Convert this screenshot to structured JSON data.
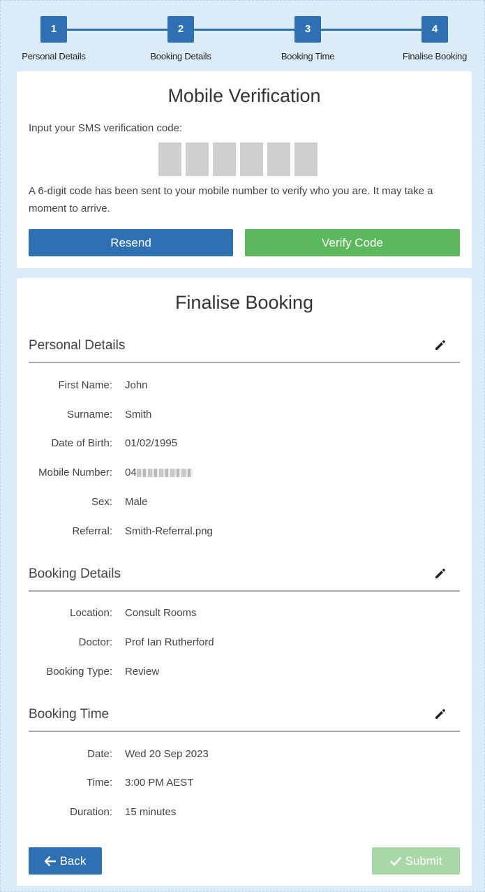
{
  "stepper": {
    "steps": [
      {
        "number": "1",
        "label": "Personal Details"
      },
      {
        "number": "2",
        "label": "Booking Details"
      },
      {
        "number": "3",
        "label": "Booking Time"
      },
      {
        "number": "4",
        "label": "Finalise Booking"
      }
    ]
  },
  "verify": {
    "title": "Mobile Verification",
    "prompt": "Input your SMS verification code:",
    "code_digits": [
      "",
      "",
      "",
      "",
      "",
      ""
    ],
    "note": "A 6-digit code has been sent to your mobile number to verify who you are. It may take a moment to arrive.",
    "resend_label": "Resend",
    "verify_label": "Verify Code"
  },
  "finalise": {
    "title": "Finalise Booking",
    "personal": {
      "heading": "Personal Details",
      "rows": [
        {
          "label": "First Name:",
          "value": "John"
        },
        {
          "label": "Surname:",
          "value": "Smith"
        },
        {
          "label": "Date of Birth:",
          "value": "01/02/1995"
        },
        {
          "label": "Mobile Number:",
          "value": "04"
        },
        {
          "label": "Sex:",
          "value": "Male"
        },
        {
          "label": "Referral:",
          "value": "Smith-Referral.png"
        }
      ]
    },
    "booking": {
      "heading": "Booking Details",
      "rows": [
        {
          "label": "Location:",
          "value": "Consult Rooms"
        },
        {
          "label": "Doctor:",
          "value": "Prof Ian Rutherford"
        },
        {
          "label": "Booking Type:",
          "value": "Review"
        }
      ]
    },
    "time": {
      "heading": "Booking Time",
      "rows": [
        {
          "label": "Date:",
          "value": "Wed 20 Sep 2023"
        },
        {
          "label": "Time:",
          "value": "3:00 PM AEST"
        },
        {
          "label": "Duration:",
          "value": "15 minutes"
        }
      ]
    },
    "back_label": "Back",
    "submit_label": "Submit"
  },
  "colors": {
    "primary": "#2f70b3",
    "success": "#5cb85c",
    "success_disabled": "#a8d8a8",
    "background": "#dcebf8"
  },
  "icons": {
    "edit": "pencil-icon",
    "back": "arrow-left-icon",
    "submit": "check-icon"
  }
}
